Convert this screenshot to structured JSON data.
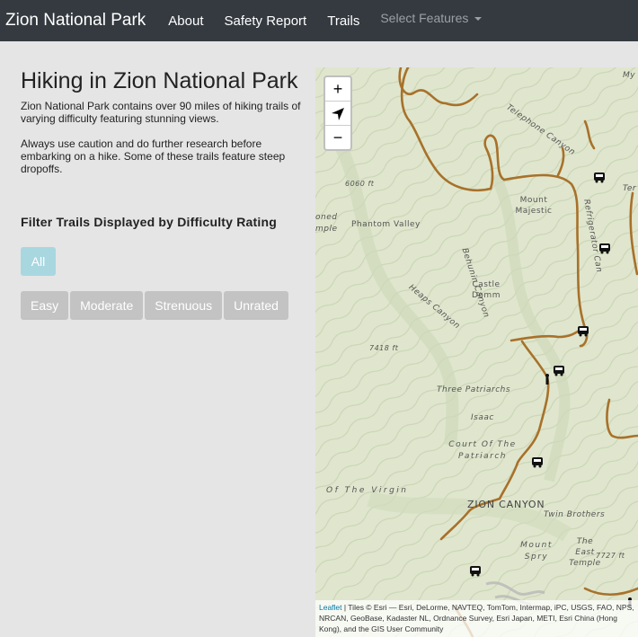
{
  "navbar": {
    "brand": "Zion National Park",
    "links": [
      "About",
      "Safety Report",
      "Trails"
    ],
    "dropdown": "Select Features"
  },
  "main": {
    "title": "Hiking in Zion National Park",
    "intro": "Zion National Park contains over 90 miles of hiking trails of varying difficulty featuring stunning views.",
    "caution": "Always use caution and do further research before embarking on a hike. Some of these trails feature steep dropoffs.",
    "filter_heading": "Filter Trails Displayed by Difficulty Rating",
    "filters": {
      "all": "All",
      "easy": "Easy",
      "moderate": "Moderate",
      "strenuous": "Strenuous",
      "unrated": "Unrated"
    }
  },
  "map": {
    "zoom_in": "+",
    "zoom_out": "−",
    "attribution_link": "Leaflet",
    "attribution_text": " | Tiles © Esri — Esri, DeLorme, NAVTEQ, TomTom, Intermap, iPC, USGS, FAO, NPS, NRCAN, GeoBase, Kadaster NL, Ordnance Survey, Esri Japan, METI, Esri China (Hong Kong), and the GIS User Community",
    "labels": {
      "telephone_canyon": "Telephone Canyon",
      "mount_majestic": "Mount Majestic",
      "phantom_valley": "Phantom Valley",
      "behunin_canyon": "Behunin Canyon",
      "castle_dome": "Castle Domm",
      "heaps_canyon": "Heaps Canyon",
      "refrigerator_canyon": "Refrigerator Can",
      "elev_6060": "6060 ft",
      "elev_7418": "7418 ft",
      "three_patriarchs": "Three Patriarchs",
      "isaac": "Isaac",
      "court_patriarchs": "Court Of The Patriarch",
      "of_the_virgin": "Of The Virgin",
      "zion_canyon": "ZION CANYON",
      "twin_brothers": "Twin Brothers",
      "mount_spry": "Mount Spry",
      "east_temple": "The East Temple",
      "elev_7727": "7727 ft",
      "my": "My",
      "ter": "Ter",
      "oned": "oned",
      "mple": "mple"
    }
  }
}
